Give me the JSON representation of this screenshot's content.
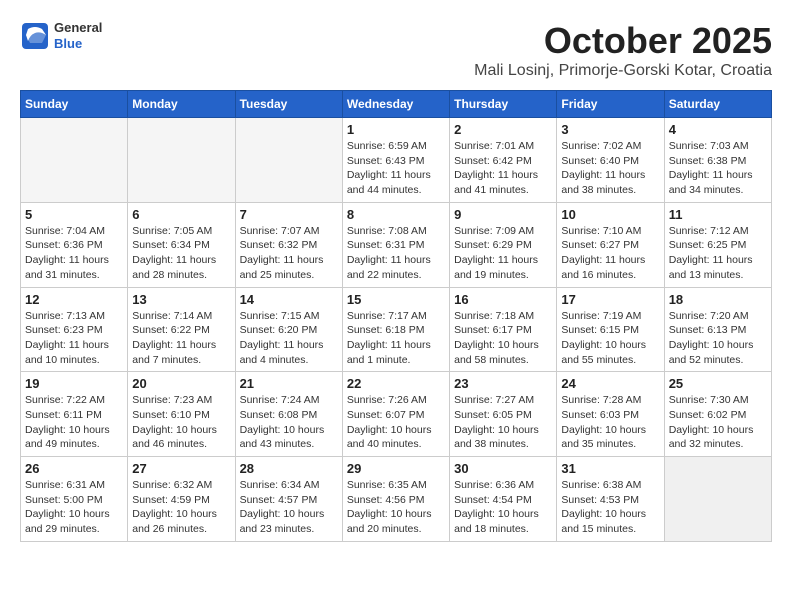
{
  "header": {
    "logo_line1": "General",
    "logo_line2": "Blue",
    "month": "October 2025",
    "location": "Mali Losinj, Primorje-Gorski Kotar, Croatia"
  },
  "weekdays": [
    "Sunday",
    "Monday",
    "Tuesday",
    "Wednesday",
    "Thursday",
    "Friday",
    "Saturday"
  ],
  "weeks": [
    [
      {
        "day": "",
        "info": ""
      },
      {
        "day": "",
        "info": ""
      },
      {
        "day": "",
        "info": ""
      },
      {
        "day": "1",
        "info": "Sunrise: 6:59 AM\nSunset: 6:43 PM\nDaylight: 11 hours\nand 44 minutes."
      },
      {
        "day": "2",
        "info": "Sunrise: 7:01 AM\nSunset: 6:42 PM\nDaylight: 11 hours\nand 41 minutes."
      },
      {
        "day": "3",
        "info": "Sunrise: 7:02 AM\nSunset: 6:40 PM\nDaylight: 11 hours\nand 38 minutes."
      },
      {
        "day": "4",
        "info": "Sunrise: 7:03 AM\nSunset: 6:38 PM\nDaylight: 11 hours\nand 34 minutes."
      }
    ],
    [
      {
        "day": "5",
        "info": "Sunrise: 7:04 AM\nSunset: 6:36 PM\nDaylight: 11 hours\nand 31 minutes."
      },
      {
        "day": "6",
        "info": "Sunrise: 7:05 AM\nSunset: 6:34 PM\nDaylight: 11 hours\nand 28 minutes."
      },
      {
        "day": "7",
        "info": "Sunrise: 7:07 AM\nSunset: 6:32 PM\nDaylight: 11 hours\nand 25 minutes."
      },
      {
        "day": "8",
        "info": "Sunrise: 7:08 AM\nSunset: 6:31 PM\nDaylight: 11 hours\nand 22 minutes."
      },
      {
        "day": "9",
        "info": "Sunrise: 7:09 AM\nSunset: 6:29 PM\nDaylight: 11 hours\nand 19 minutes."
      },
      {
        "day": "10",
        "info": "Sunrise: 7:10 AM\nSunset: 6:27 PM\nDaylight: 11 hours\nand 16 minutes."
      },
      {
        "day": "11",
        "info": "Sunrise: 7:12 AM\nSunset: 6:25 PM\nDaylight: 11 hours\nand 13 minutes."
      }
    ],
    [
      {
        "day": "12",
        "info": "Sunrise: 7:13 AM\nSunset: 6:23 PM\nDaylight: 11 hours\nand 10 minutes."
      },
      {
        "day": "13",
        "info": "Sunrise: 7:14 AM\nSunset: 6:22 PM\nDaylight: 11 hours\nand 7 minutes."
      },
      {
        "day": "14",
        "info": "Sunrise: 7:15 AM\nSunset: 6:20 PM\nDaylight: 11 hours\nand 4 minutes."
      },
      {
        "day": "15",
        "info": "Sunrise: 7:17 AM\nSunset: 6:18 PM\nDaylight: 11 hours\nand 1 minute."
      },
      {
        "day": "16",
        "info": "Sunrise: 7:18 AM\nSunset: 6:17 PM\nDaylight: 10 hours\nand 58 minutes."
      },
      {
        "day": "17",
        "info": "Sunrise: 7:19 AM\nSunset: 6:15 PM\nDaylight: 10 hours\nand 55 minutes."
      },
      {
        "day": "18",
        "info": "Sunrise: 7:20 AM\nSunset: 6:13 PM\nDaylight: 10 hours\nand 52 minutes."
      }
    ],
    [
      {
        "day": "19",
        "info": "Sunrise: 7:22 AM\nSunset: 6:11 PM\nDaylight: 10 hours\nand 49 minutes."
      },
      {
        "day": "20",
        "info": "Sunrise: 7:23 AM\nSunset: 6:10 PM\nDaylight: 10 hours\nand 46 minutes."
      },
      {
        "day": "21",
        "info": "Sunrise: 7:24 AM\nSunset: 6:08 PM\nDaylight: 10 hours\nand 43 minutes."
      },
      {
        "day": "22",
        "info": "Sunrise: 7:26 AM\nSunset: 6:07 PM\nDaylight: 10 hours\nand 40 minutes."
      },
      {
        "day": "23",
        "info": "Sunrise: 7:27 AM\nSunset: 6:05 PM\nDaylight: 10 hours\nand 38 minutes."
      },
      {
        "day": "24",
        "info": "Sunrise: 7:28 AM\nSunset: 6:03 PM\nDaylight: 10 hours\nand 35 minutes."
      },
      {
        "day": "25",
        "info": "Sunrise: 7:30 AM\nSunset: 6:02 PM\nDaylight: 10 hours\nand 32 minutes."
      }
    ],
    [
      {
        "day": "26",
        "info": "Sunrise: 6:31 AM\nSunset: 5:00 PM\nDaylight: 10 hours\nand 29 minutes."
      },
      {
        "day": "27",
        "info": "Sunrise: 6:32 AM\nSunset: 4:59 PM\nDaylight: 10 hours\nand 26 minutes."
      },
      {
        "day": "28",
        "info": "Sunrise: 6:34 AM\nSunset: 4:57 PM\nDaylight: 10 hours\nand 23 minutes."
      },
      {
        "day": "29",
        "info": "Sunrise: 6:35 AM\nSunset: 4:56 PM\nDaylight: 10 hours\nand 20 minutes."
      },
      {
        "day": "30",
        "info": "Sunrise: 6:36 AM\nSunset: 4:54 PM\nDaylight: 10 hours\nand 18 minutes."
      },
      {
        "day": "31",
        "info": "Sunrise: 6:38 AM\nSunset: 4:53 PM\nDaylight: 10 hours\nand 15 minutes."
      },
      {
        "day": "",
        "info": ""
      }
    ]
  ]
}
